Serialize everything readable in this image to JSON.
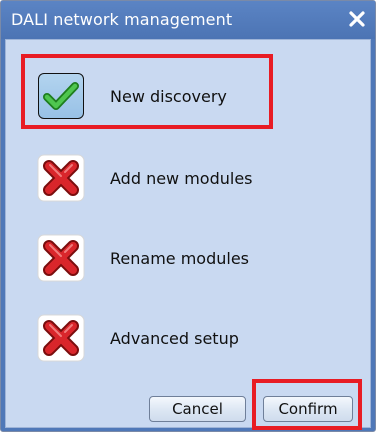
{
  "dialog": {
    "title": "DALI network management",
    "close_icon": "close-icon"
  },
  "options": [
    {
      "label": "New discovery",
      "icon": "checkmark-icon",
      "status": "enabled"
    },
    {
      "label": "Add new modules",
      "icon": "red-x-icon",
      "status": "disabled"
    },
    {
      "label": "Rename modules",
      "icon": "red-x-icon",
      "status": "disabled"
    },
    {
      "label": "Advanced setup",
      "icon": "red-x-icon",
      "status": "disabled"
    }
  ],
  "buttons": {
    "cancel": "Cancel",
    "confirm": "Confirm"
  },
  "colors": {
    "title_bar": "#4f78b8",
    "panel": "#c9d9f1",
    "highlight": "#e81c24"
  }
}
